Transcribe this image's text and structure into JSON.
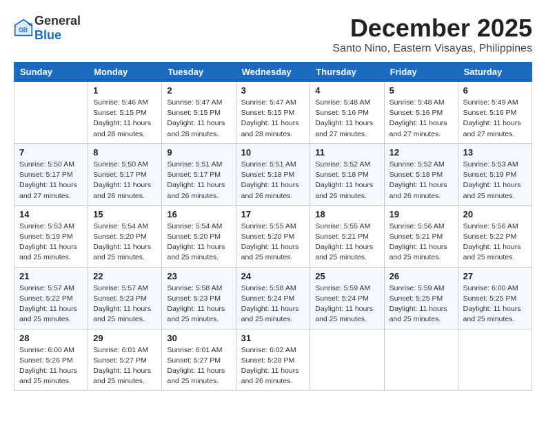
{
  "header": {
    "logo_general": "General",
    "logo_blue": "Blue",
    "title": "December 2025",
    "subtitle": "Santo Nino, Eastern Visayas, Philippines"
  },
  "weekdays": [
    "Sunday",
    "Monday",
    "Tuesday",
    "Wednesday",
    "Thursday",
    "Friday",
    "Saturday"
  ],
  "weeks": [
    [
      {
        "day": "",
        "sunrise": "",
        "sunset": "",
        "daylight": ""
      },
      {
        "day": "1",
        "sunrise": "Sunrise: 5:46 AM",
        "sunset": "Sunset: 5:15 PM",
        "daylight": "Daylight: 11 hours and 28 minutes."
      },
      {
        "day": "2",
        "sunrise": "Sunrise: 5:47 AM",
        "sunset": "Sunset: 5:15 PM",
        "daylight": "Daylight: 11 hours and 28 minutes."
      },
      {
        "day": "3",
        "sunrise": "Sunrise: 5:47 AM",
        "sunset": "Sunset: 5:15 PM",
        "daylight": "Daylight: 11 hours and 28 minutes."
      },
      {
        "day": "4",
        "sunrise": "Sunrise: 5:48 AM",
        "sunset": "Sunset: 5:16 PM",
        "daylight": "Daylight: 11 hours and 27 minutes."
      },
      {
        "day": "5",
        "sunrise": "Sunrise: 5:48 AM",
        "sunset": "Sunset: 5:16 PM",
        "daylight": "Daylight: 11 hours and 27 minutes."
      },
      {
        "day": "6",
        "sunrise": "Sunrise: 5:49 AM",
        "sunset": "Sunset: 5:16 PM",
        "daylight": "Daylight: 11 hours and 27 minutes."
      }
    ],
    [
      {
        "day": "7",
        "sunrise": "Sunrise: 5:50 AM",
        "sunset": "Sunset: 5:17 PM",
        "daylight": "Daylight: 11 hours and 27 minutes."
      },
      {
        "day": "8",
        "sunrise": "Sunrise: 5:50 AM",
        "sunset": "Sunset: 5:17 PM",
        "daylight": "Daylight: 11 hours and 26 minutes."
      },
      {
        "day": "9",
        "sunrise": "Sunrise: 5:51 AM",
        "sunset": "Sunset: 5:17 PM",
        "daylight": "Daylight: 11 hours and 26 minutes."
      },
      {
        "day": "10",
        "sunrise": "Sunrise: 5:51 AM",
        "sunset": "Sunset: 5:18 PM",
        "daylight": "Daylight: 11 hours and 26 minutes."
      },
      {
        "day": "11",
        "sunrise": "Sunrise: 5:52 AM",
        "sunset": "Sunset: 5:18 PM",
        "daylight": "Daylight: 11 hours and 26 minutes."
      },
      {
        "day": "12",
        "sunrise": "Sunrise: 5:52 AM",
        "sunset": "Sunset: 5:18 PM",
        "daylight": "Daylight: 11 hours and 26 minutes."
      },
      {
        "day": "13",
        "sunrise": "Sunrise: 5:53 AM",
        "sunset": "Sunset: 5:19 PM",
        "daylight": "Daylight: 11 hours and 25 minutes."
      }
    ],
    [
      {
        "day": "14",
        "sunrise": "Sunrise: 5:53 AM",
        "sunset": "Sunset: 5:19 PM",
        "daylight": "Daylight: 11 hours and 25 minutes."
      },
      {
        "day": "15",
        "sunrise": "Sunrise: 5:54 AM",
        "sunset": "Sunset: 5:20 PM",
        "daylight": "Daylight: 11 hours and 25 minutes."
      },
      {
        "day": "16",
        "sunrise": "Sunrise: 5:54 AM",
        "sunset": "Sunset: 5:20 PM",
        "daylight": "Daylight: 11 hours and 25 minutes."
      },
      {
        "day": "17",
        "sunrise": "Sunrise: 5:55 AM",
        "sunset": "Sunset: 5:20 PM",
        "daylight": "Daylight: 11 hours and 25 minutes."
      },
      {
        "day": "18",
        "sunrise": "Sunrise: 5:55 AM",
        "sunset": "Sunset: 5:21 PM",
        "daylight": "Daylight: 11 hours and 25 minutes."
      },
      {
        "day": "19",
        "sunrise": "Sunrise: 5:56 AM",
        "sunset": "Sunset: 5:21 PM",
        "daylight": "Daylight: 11 hours and 25 minutes."
      },
      {
        "day": "20",
        "sunrise": "Sunrise: 5:56 AM",
        "sunset": "Sunset: 5:22 PM",
        "daylight": "Daylight: 11 hours and 25 minutes."
      }
    ],
    [
      {
        "day": "21",
        "sunrise": "Sunrise: 5:57 AM",
        "sunset": "Sunset: 5:22 PM",
        "daylight": "Daylight: 11 hours and 25 minutes."
      },
      {
        "day": "22",
        "sunrise": "Sunrise: 5:57 AM",
        "sunset": "Sunset: 5:23 PM",
        "daylight": "Daylight: 11 hours and 25 minutes."
      },
      {
        "day": "23",
        "sunrise": "Sunrise: 5:58 AM",
        "sunset": "Sunset: 5:23 PM",
        "daylight": "Daylight: 11 hours and 25 minutes."
      },
      {
        "day": "24",
        "sunrise": "Sunrise: 5:58 AM",
        "sunset": "Sunset: 5:24 PM",
        "daylight": "Daylight: 11 hours and 25 minutes."
      },
      {
        "day": "25",
        "sunrise": "Sunrise: 5:59 AM",
        "sunset": "Sunset: 5:24 PM",
        "daylight": "Daylight: 11 hours and 25 minutes."
      },
      {
        "day": "26",
        "sunrise": "Sunrise: 5:59 AM",
        "sunset": "Sunset: 5:25 PM",
        "daylight": "Daylight: 11 hours and 25 minutes."
      },
      {
        "day": "27",
        "sunrise": "Sunrise: 6:00 AM",
        "sunset": "Sunset: 5:25 PM",
        "daylight": "Daylight: 11 hours and 25 minutes."
      }
    ],
    [
      {
        "day": "28",
        "sunrise": "Sunrise: 6:00 AM",
        "sunset": "Sunset: 5:26 PM",
        "daylight": "Daylight: 11 hours and 25 minutes."
      },
      {
        "day": "29",
        "sunrise": "Sunrise: 6:01 AM",
        "sunset": "Sunset: 5:27 PM",
        "daylight": "Daylight: 11 hours and 25 minutes."
      },
      {
        "day": "30",
        "sunrise": "Sunrise: 6:01 AM",
        "sunset": "Sunset: 5:27 PM",
        "daylight": "Daylight: 11 hours and 25 minutes."
      },
      {
        "day": "31",
        "sunrise": "Sunrise: 6:02 AM",
        "sunset": "Sunset: 5:28 PM",
        "daylight": "Daylight: 11 hours and 26 minutes."
      },
      {
        "day": "",
        "sunrise": "",
        "sunset": "",
        "daylight": ""
      },
      {
        "day": "",
        "sunrise": "",
        "sunset": "",
        "daylight": ""
      },
      {
        "day": "",
        "sunrise": "",
        "sunset": "",
        "daylight": ""
      }
    ]
  ]
}
